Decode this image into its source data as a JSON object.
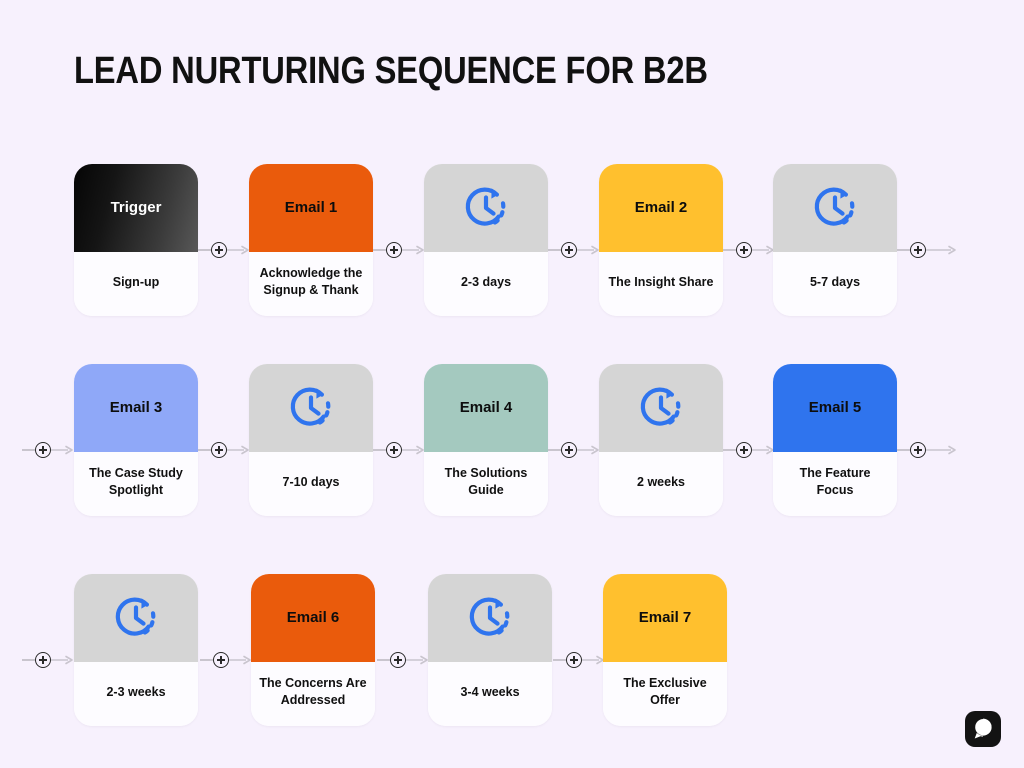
{
  "title": "LEAD NURTURING SEQUENCE FOR B2B",
  "background_color": "#f7f1fd",
  "accent_icon_color": "#2f74ee",
  "connector_color": "#c9c5ce",
  "logo": {
    "name": "brand-logo",
    "shape": "rounded-square-with-speech-bubble",
    "color": "#121212"
  },
  "rows": [
    {
      "index": 0,
      "nodes": [
        {
          "type": "trigger",
          "head_label": "Trigger",
          "body_label": "Sign-up",
          "head_color": "#0a0a0a",
          "head_text_color": "#ffffff",
          "icon": ""
        },
        {
          "type": "email",
          "head_label": "Email 1",
          "body_label": "Acknowledge the Signup & Thank",
          "head_color": "#ea5b0c",
          "head_text_color": "#0d0d0d",
          "icon": ""
        },
        {
          "type": "delay",
          "head_label": "",
          "body_label": "2-3 days",
          "head_color": "#d5d5d5",
          "head_text_color": "#0d0d0d",
          "icon": "clock-dashed-icon"
        },
        {
          "type": "email",
          "head_label": "Email 2",
          "body_label": "The Insight Share",
          "head_color": "#ffc02e",
          "head_text_color": "#0d0d0d",
          "icon": ""
        },
        {
          "type": "delay",
          "head_label": "",
          "body_label": "5-7 days",
          "head_color": "#d5d5d5",
          "head_text_color": "#0d0d0d",
          "icon": "clock-dashed-icon"
        }
      ]
    },
    {
      "index": 1,
      "nodes": [
        {
          "type": "email",
          "head_label": "Email 3",
          "body_label": "The Case Study Spotlight",
          "head_color": "#8fa8f8",
          "head_text_color": "#0d0d0d",
          "icon": ""
        },
        {
          "type": "delay",
          "head_label": "",
          "body_label": "7-10 days",
          "head_color": "#d5d5d5",
          "head_text_color": "#0d0d0d",
          "icon": "clock-dashed-icon"
        },
        {
          "type": "email",
          "head_label": "Email 4",
          "body_label": "The Solutions Guide",
          "head_color": "#a4c9bf",
          "head_text_color": "#0d0d0d",
          "icon": ""
        },
        {
          "type": "delay",
          "head_label": "",
          "body_label": "2 weeks",
          "head_color": "#d5d5d5",
          "head_text_color": "#0d0d0d",
          "icon": "clock-dashed-icon"
        },
        {
          "type": "email",
          "head_label": "Email 5",
          "body_label": "The Feature Focus",
          "head_color": "#2f74ee",
          "head_text_color": "#0d0d0d",
          "icon": ""
        }
      ]
    },
    {
      "index": 2,
      "nodes": [
        {
          "type": "delay",
          "head_label": "",
          "body_label": "2-3 weeks",
          "head_color": "#d5d5d5",
          "head_text_color": "#0d0d0d",
          "icon": "clock-dashed-icon"
        },
        {
          "type": "email",
          "head_label": "Email 6",
          "body_label": "The Concerns Are Addressed",
          "head_color": "#ea5b0c",
          "head_text_color": "#0d0d0d",
          "icon": ""
        },
        {
          "type": "delay",
          "head_label": "",
          "body_label": "3-4 weeks",
          "head_color": "#d5d5d5",
          "head_text_color": "#0d0d0d",
          "icon": "clock-dashed-icon"
        },
        {
          "type": "email",
          "head_label": "Email 7",
          "body_label": "The Exclusive Offer",
          "head_color": "#ffc02e",
          "head_text_color": "#0d0d0d",
          "icon": ""
        }
      ]
    }
  ]
}
